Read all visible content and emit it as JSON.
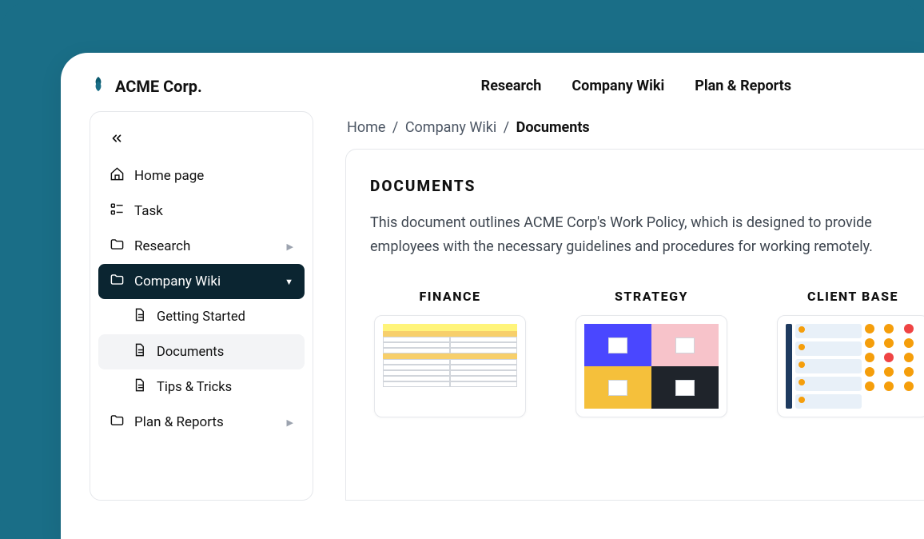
{
  "brand": {
    "name": "ACME Corp."
  },
  "topnav": {
    "items": [
      "Research",
      "Company Wiki",
      "Plan & Reports"
    ]
  },
  "sidebar": {
    "items": [
      {
        "label": "Home page"
      },
      {
        "label": "Task"
      },
      {
        "label": "Research"
      },
      {
        "label": "Company Wiki"
      },
      {
        "label": "Getting Started"
      },
      {
        "label": "Documents"
      },
      {
        "label": "Tips & Tricks"
      },
      {
        "label": "Plan & Reports"
      }
    ]
  },
  "breadcrumb": {
    "parts": [
      "Home",
      "Company Wiki",
      "Documents"
    ]
  },
  "page": {
    "heading": "DOCUMENTS",
    "description": "This document outlines ACME Corp's Work Policy, which is designed to provide employees with the necessary guidelines and procedures for working remotely."
  },
  "cards": [
    {
      "title": "FINANCE"
    },
    {
      "title": "STRATEGY"
    },
    {
      "title": "CLIENT BASE"
    }
  ]
}
